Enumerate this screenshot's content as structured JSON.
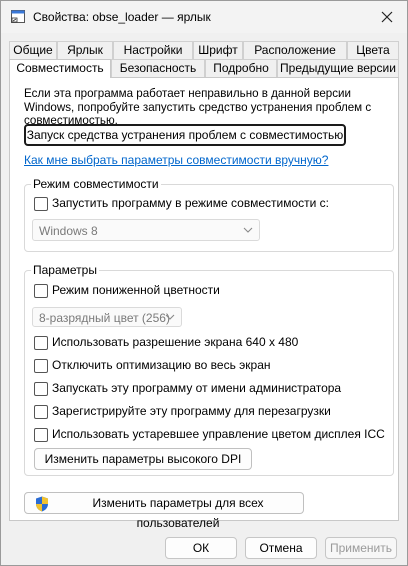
{
  "window": {
    "title": "Свойства: obse_loader — ярлык"
  },
  "tabs_row_back": [
    "Общие",
    "Ярлык",
    "Настройки",
    "Шрифт",
    "Расположение",
    "Цвета"
  ],
  "tabs_row_front": [
    "Совместимость",
    "Безопасность",
    "Подробно",
    "Предыдущие версии"
  ],
  "main": {
    "intro_text": "Если эта программа работает неправильно в данной версии Windows, попробуйте запустить средство устранения проблем с совместимостью.",
    "troubleshoot_button": "Запуск средства устранения проблем с совместимостью",
    "manual_link": "Как мне выбрать параметры совместимости вручную?"
  },
  "compat_mode": {
    "group_title": "Режим совместимости",
    "checkbox_label": "Запустить программу в режиме совместимости с:",
    "os_select_value": "Windows 8"
  },
  "settings": {
    "group_title": "Параметры",
    "reduced_color_label": "Режим пониженной цветности",
    "color_select_value": "8-разрядный цвет (256)",
    "options": [
      "Использовать разрешение экрана 640 x 480",
      "Отключить оптимизацию во весь экран",
      "Запускать эту программу от имени администратора",
      "Зарегистрируйте эту программу для перезагрузки",
      "Использовать устаревшее управление цветом дисплея ICC"
    ],
    "dpi_button": "Изменить параметры высокого DPI"
  },
  "all_users_button": "Изменить параметры для всех пользователей",
  "footer": {
    "ok": "ОК",
    "cancel": "Отмена",
    "apply": "Применить"
  },
  "colors": {
    "link": "#0066cc",
    "shield_blue": "#2b6cd4",
    "shield_yellow": "#f2c230"
  }
}
